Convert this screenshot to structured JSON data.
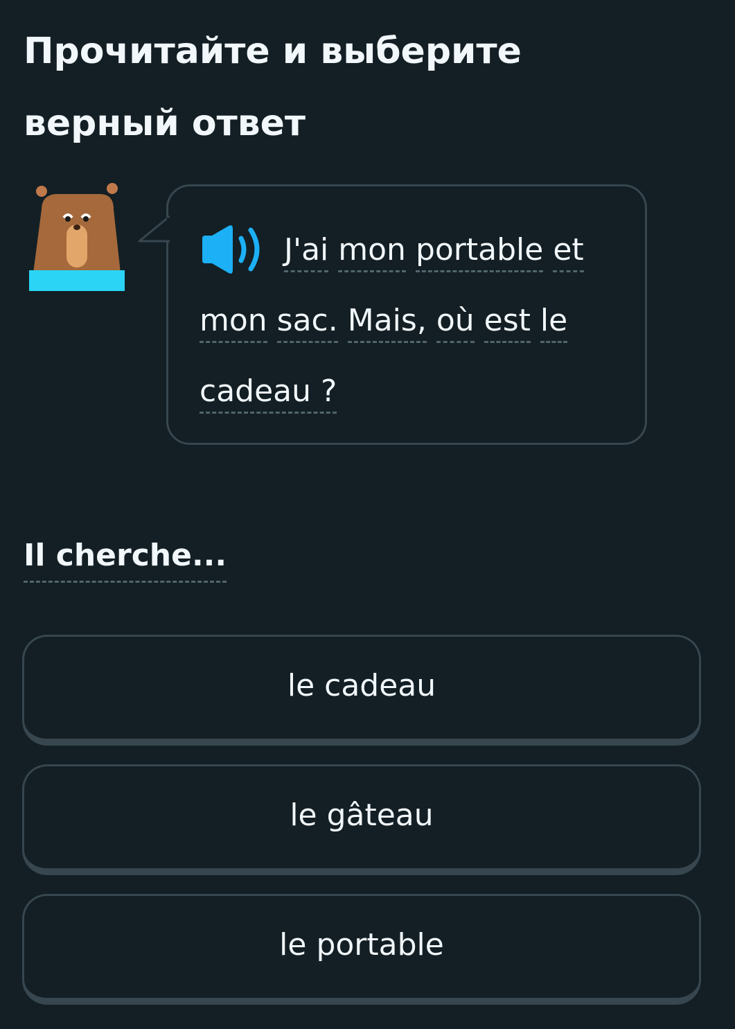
{
  "header": {
    "title": "Прочитайте и выберите верный ответ"
  },
  "character": {
    "icon": "bear-character-icon"
  },
  "bubble": {
    "speaker_icon": "speaker-icon",
    "words": [
      "J'ai",
      "mon",
      "portable",
      "et",
      "mon",
      "sac.",
      "Mais,",
      "où",
      "est",
      "le",
      "cadeau ?"
    ]
  },
  "prompt": {
    "text": "Il cherche..."
  },
  "options": [
    {
      "label": "le cadeau"
    },
    {
      "label": "le gâteau"
    },
    {
      "label": "le portable"
    }
  ],
  "colors": {
    "background": "#131f24",
    "border": "#37464f",
    "text": "#f1f7fb",
    "speaker": "#1cb0f6",
    "bear_collar": "#49c0f8",
    "bear_body": "#a5693c"
  }
}
